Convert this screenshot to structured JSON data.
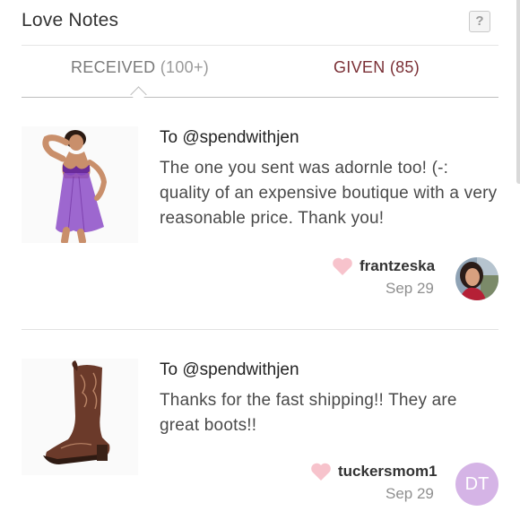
{
  "header": {
    "title": "Love Notes",
    "help_label": "?"
  },
  "tabs": [
    {
      "label": "RECEIVED",
      "count": "(100+)",
      "active": true
    },
    {
      "label": "GIVEN",
      "count": "(85)",
      "active": false
    }
  ],
  "notes": [
    {
      "to": "To @spendwithjen",
      "message": "The one you sent was adornle too! (-: quality of an expensive boutique with a very reasonable price. Thank you!",
      "user": "frantzeska",
      "date": "Sep 29",
      "product_icon": "lingerie-product-image"
    },
    {
      "to": "To @spendwithjen",
      "message": "Thanks for the fast shipping!! They are great boots!!",
      "user": "tuckersmom1",
      "date": "Sep 29",
      "product_icon": "cowboy-boot-product-image",
      "avatar_initials": "DT"
    }
  ],
  "colors": {
    "given_tab": "#7a2f35",
    "heart": "#f7c3cc",
    "avatar_initials_bg": "#d5b4e6"
  }
}
